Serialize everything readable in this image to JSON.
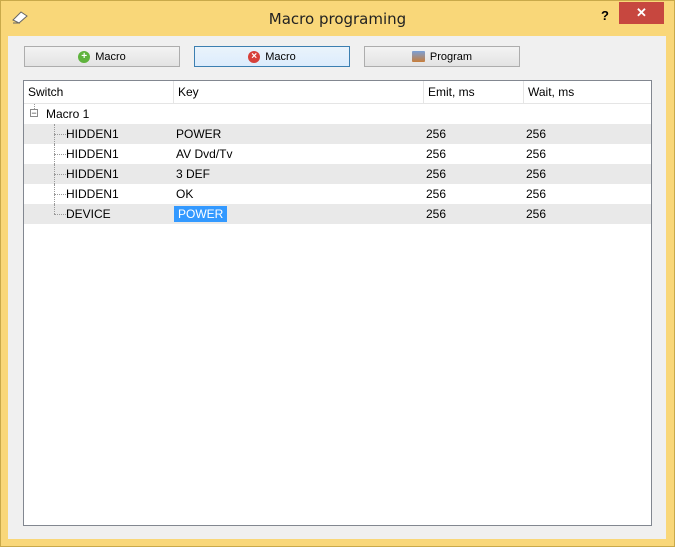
{
  "window": {
    "title": "Macro programing",
    "help_label": "?",
    "close_label": "✕"
  },
  "toolbar": {
    "add_macro_label": "Macro",
    "remove_macro_label": "Macro",
    "program_label": "Program"
  },
  "tree": {
    "columns": [
      "Switch",
      "Key",
      "Emit, ms",
      "Wait, ms"
    ],
    "group_label": "Macro 1",
    "rows": [
      {
        "switch": "HIDDEN1",
        "key": "POWER",
        "emit": "256",
        "wait": "256"
      },
      {
        "switch": "HIDDEN1",
        "key": "AV Dvd/Tv",
        "emit": "256",
        "wait": "256"
      },
      {
        "switch": "HIDDEN1",
        "key": "3 DEF",
        "emit": "256",
        "wait": "256"
      },
      {
        "switch": "HIDDEN1",
        "key": "OK",
        "emit": "256",
        "wait": "256"
      },
      {
        "switch": "DEVICE",
        "key": "POWER",
        "emit": "256",
        "wait": "256"
      }
    ]
  },
  "colors": {
    "titlebar": "#f9d779",
    "selection": "#3399ff",
    "close": "#c7473f"
  }
}
